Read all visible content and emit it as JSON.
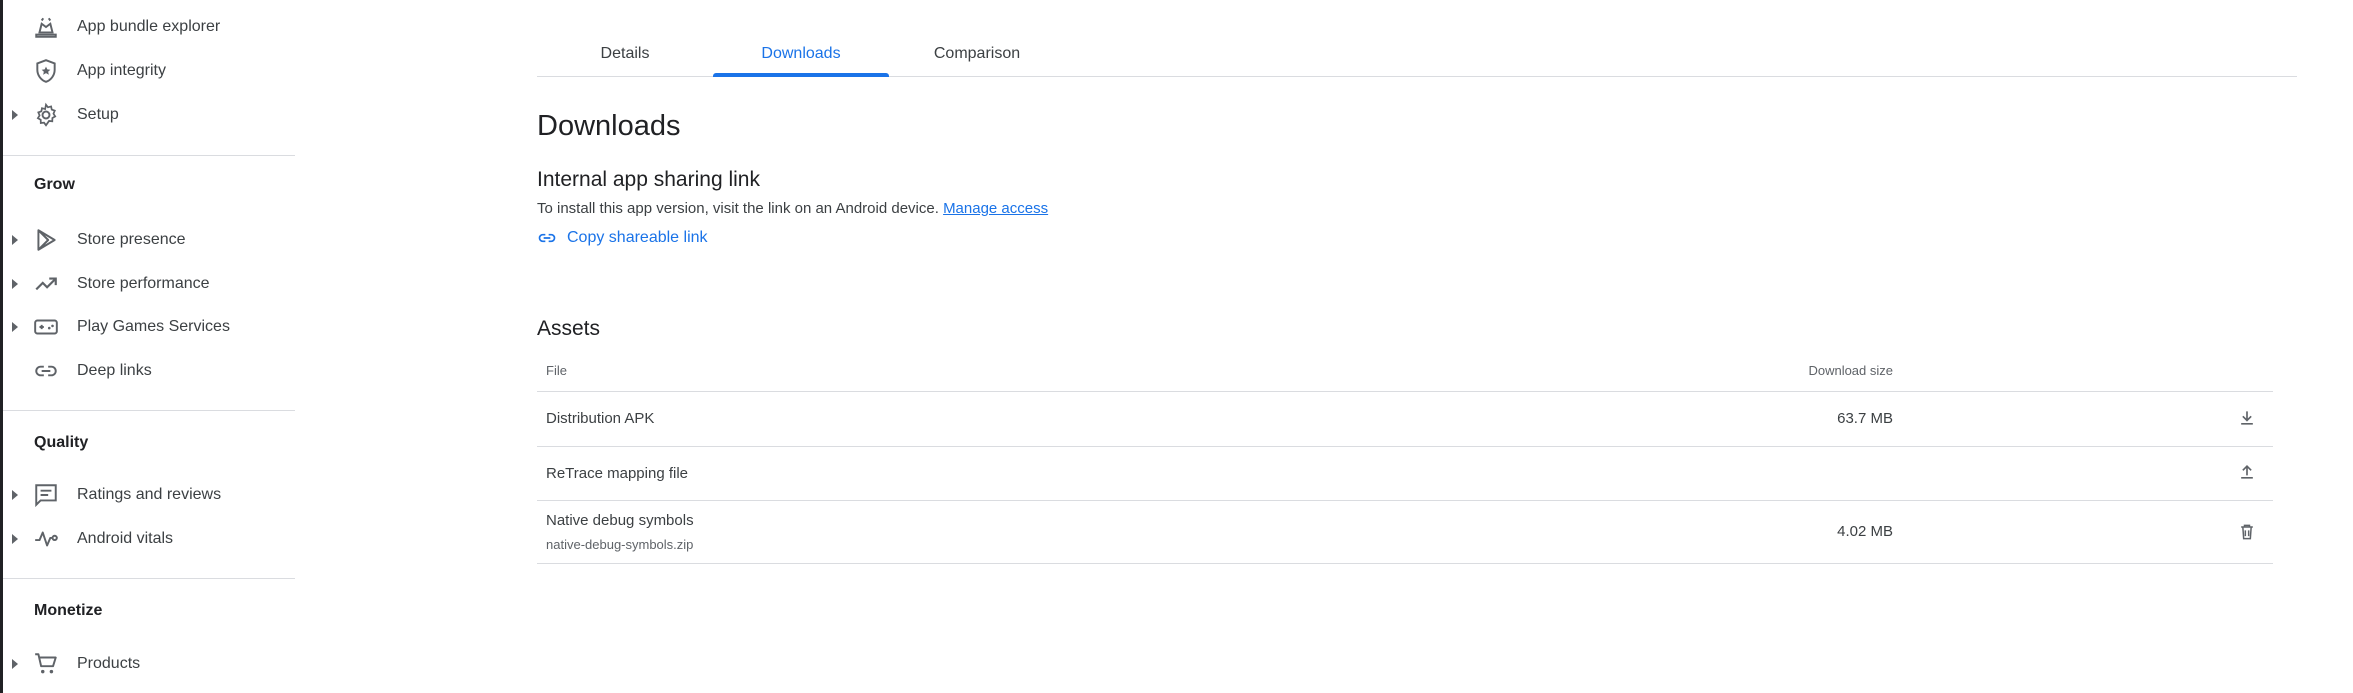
{
  "sidebar": {
    "items_top": [
      {
        "label": "App bundle explorer",
        "icon": "bundle-icon",
        "expandable": false
      },
      {
        "label": "App integrity",
        "icon": "shield-icon",
        "expandable": false
      },
      {
        "label": "Setup",
        "icon": "gear-icon",
        "expandable": true
      }
    ],
    "sections": [
      {
        "title": "Grow",
        "items": [
          {
            "label": "Store presence",
            "icon": "play-icon",
            "expandable": true
          },
          {
            "label": "Store performance",
            "icon": "trending-up-icon",
            "expandable": true
          },
          {
            "label": "Play Games Services",
            "icon": "gamepad-icon",
            "expandable": true
          },
          {
            "label": "Deep links",
            "icon": "link-icon",
            "expandable": false
          }
        ]
      },
      {
        "title": "Quality",
        "items": [
          {
            "label": "Ratings and reviews",
            "icon": "reviews-icon",
            "expandable": true
          },
          {
            "label": "Android vitals",
            "icon": "vitals-icon",
            "expandable": true
          }
        ]
      },
      {
        "title": "Monetize",
        "items": [
          {
            "label": "Products",
            "icon": "cart-icon",
            "expandable": true
          }
        ]
      }
    ]
  },
  "tabs": [
    {
      "label": "Details",
      "active": false
    },
    {
      "label": "Downloads",
      "active": true
    },
    {
      "label": "Comparison",
      "active": false
    }
  ],
  "main": {
    "title": "Downloads",
    "sharing": {
      "heading": "Internal app sharing link",
      "description": "To install this app version, visit the link on an Android device.",
      "manage_link": "Manage access",
      "copy_link": "Copy shareable link"
    },
    "assets": {
      "heading": "Assets",
      "columns": {
        "file": "File",
        "size": "Download size"
      },
      "rows": [
        {
          "file": "Distribution APK",
          "subtitle": "",
          "size": "63.7 MB",
          "action_icon": "download-icon"
        },
        {
          "file": "ReTrace mapping file",
          "subtitle": "",
          "size": "",
          "action_icon": "upload-icon"
        },
        {
          "file": "Native debug symbols",
          "subtitle": "native-debug-symbols.zip",
          "size": "4.02 MB",
          "action_icon": "delete-icon"
        }
      ]
    }
  },
  "colors": {
    "accent": "#1a73e8",
    "text": "#202124",
    "muted": "#5f6368",
    "divider": "#dadce0"
  }
}
